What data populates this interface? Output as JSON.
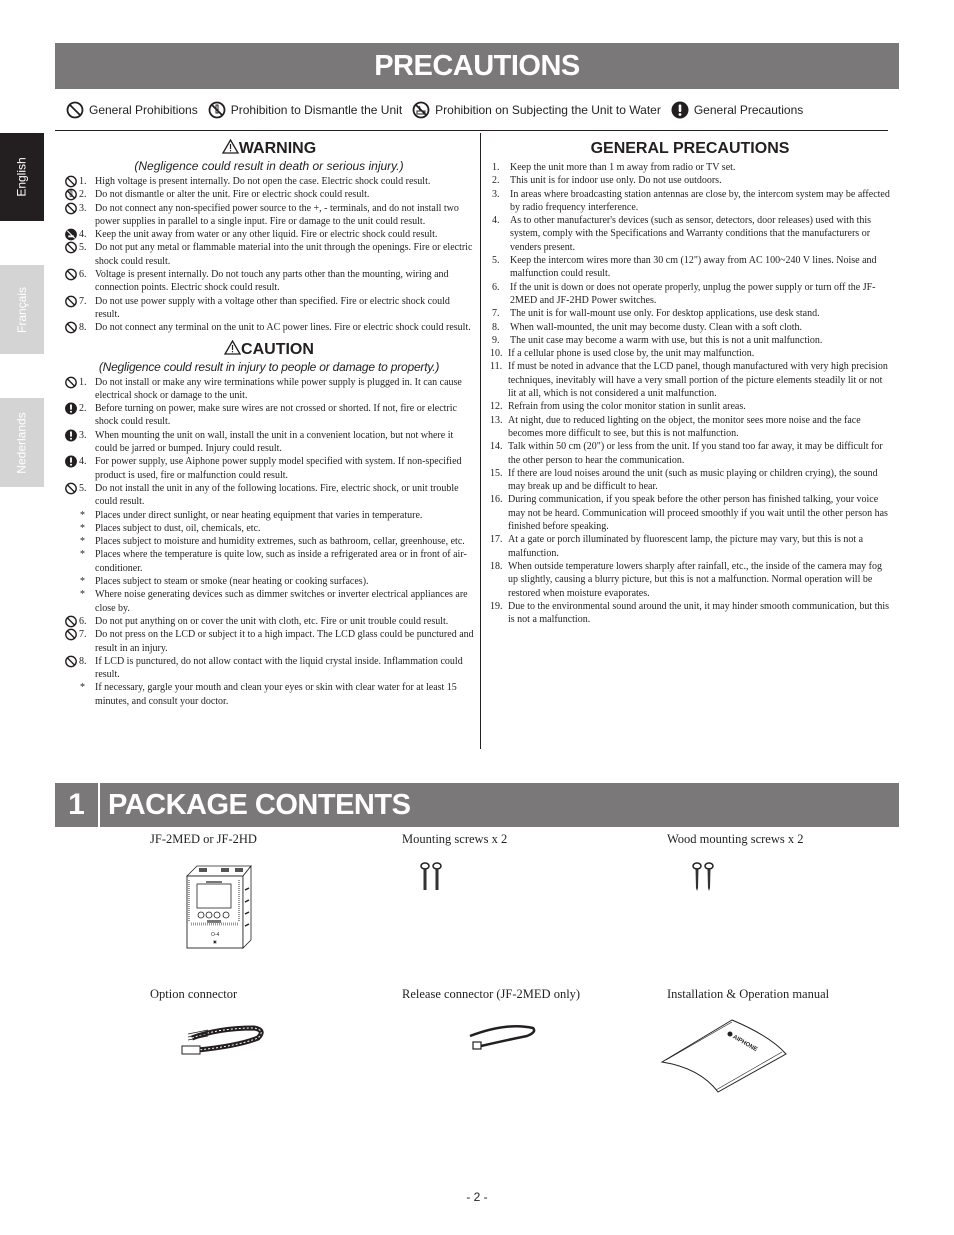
{
  "header": {
    "title": "PRECAUTIONS"
  },
  "legend": [
    {
      "icon": "general-prohibition-icon",
      "label": "General Prohibitions"
    },
    {
      "icon": "no-dismantle-icon",
      "label": "Prohibition to Dismantle the Unit"
    },
    {
      "icon": "no-water-icon",
      "label": "Prohibition on Subjecting the Unit to Water"
    },
    {
      "icon": "general-precaution-icon",
      "label": "General Precautions"
    }
  ],
  "language_tabs": [
    {
      "label": "English",
      "active": true
    },
    {
      "label": "Français",
      "active": false
    },
    {
      "label": "Nederlands",
      "active": false
    }
  ],
  "warning": {
    "title": "WARNING",
    "subtitle": "(Negligence could result in death or serious injury.)",
    "items": [
      {
        "icon": "prohibition",
        "num": "1.",
        "text": "High voltage is present internally. Do not open the case. Electric shock could result."
      },
      {
        "icon": "dismantle",
        "num": "2.",
        "text": "Do not dismantle or alter the unit. Fire or electric shock could result."
      },
      {
        "icon": "prohibition",
        "num": "3.",
        "text": "Do not connect any non-specified power source to the +, - terminals, and do not install two power supplies in parallel to a single input. Fire or damage to the unit could result."
      },
      {
        "icon": "water",
        "num": "4.",
        "text": "Keep the unit away from water or any other liquid. Fire or electric shock could result."
      },
      {
        "icon": "prohibition",
        "num": "5.",
        "text": "Do not put any metal or flammable material into the unit through the openings. Fire or electric shock could result."
      },
      {
        "icon": "prohibition",
        "num": "6.",
        "text": "Voltage is present internally. Do not touch any parts other than the mounting, wiring and connection points. Electric shock could result."
      },
      {
        "icon": "prohibition",
        "num": "7.",
        "text": "Do not use power supply with a voltage other than specified. Fire or electric shock could result."
      },
      {
        "icon": "prohibition",
        "num": "8.",
        "text": "Do not connect any terminal on the unit to AC power lines. Fire or electric shock could result."
      }
    ]
  },
  "caution": {
    "title": "CAUTION",
    "subtitle": "(Negligence could result in injury to people or damage to property.)",
    "items": [
      {
        "icon": "prohibition",
        "num": "1.",
        "text": "Do not install or make any wire terminations while power supply is plugged in. It can cause electrical shock or damage to the unit."
      },
      {
        "icon": "precaution",
        "num": "2.",
        "text": "Before turning on power, make sure wires are not crossed or shorted. If not, fire or electric shock could result."
      },
      {
        "icon": "precaution",
        "num": "3.",
        "text": "When mounting the unit on wall, install the unit in a convenient location, but not where it could be jarred or bumped. Injury could result."
      },
      {
        "icon": "precaution",
        "num": "4.",
        "text": "For power supply, use Aiphone power supply model specified with system. If non-specified product is used, fire or malfunction could result."
      },
      {
        "icon": "prohibition",
        "num": "5.",
        "text": "Do not install the unit in any of the following locations. Fire, electric shock, or unit trouble could result.",
        "subitems": [
          "Places under direct sunlight, or near heating equipment that varies in temperature.",
          "Places subject to dust, oil, chemicals, etc.",
          "Places subject to moisture and humidity extremes, such as bathroom, cellar, greenhouse, etc.",
          "Places where the temperature is quite low, such as inside a refrigerated area or in front of air-conditioner.",
          "Places subject to steam or smoke (near heating or cooking surfaces).",
          "Where noise generating devices such as dimmer switches or inverter electrical appliances are close by."
        ]
      },
      {
        "icon": "prohibition",
        "num": "6.",
        "text": "Do not put anything on or cover the unit with cloth, etc. Fire or unit trouble could result."
      },
      {
        "icon": "prohibition",
        "num": "7.",
        "text": "Do not press on the LCD or subject it to a high impact. The LCD glass could be punctured and result in an injury."
      },
      {
        "icon": "prohibition",
        "num": "8.",
        "text": "If LCD is punctured, do not allow contact with the liquid crystal inside. Inflammation could result.",
        "subitems": [
          "If necessary, gargle your mouth and clean your eyes or skin with clear water for at least 15 minutes, and consult your doctor."
        ]
      }
    ]
  },
  "general": {
    "title": "GENERAL PRECAUTIONS",
    "items": [
      {
        "num": "1.",
        "text": "Keep the unit more than 1 m away from radio or TV set."
      },
      {
        "num": "2.",
        "text": "This unit is for indoor use only. Do not use outdoors."
      },
      {
        "num": "3.",
        "text": "In areas where broadcasting station antennas are close by, the intercom system may be affected by radio frequency interference."
      },
      {
        "num": "4.",
        "text": "As to other manufacturer's devices (such as sensor, detectors, door releases) used with this system, comply with the Specifications and Warranty conditions that the manufacturers or venders present."
      },
      {
        "num": "5.",
        "text": "Keep the intercom wires more than 30 cm (12\") away from AC 100~240 V lines. Noise and malfunction could result."
      },
      {
        "num": "6.",
        "text": "If the unit is down or does not operate properly, unplug the power supply or turn off the JF-2MED and JF-2HD Power switches."
      },
      {
        "num": "7.",
        "text": "The unit is for wall-mount use only. For desktop applications, use desk stand."
      },
      {
        "num": "8.",
        "text": "When wall-mounted, the unit may become dusty. Clean with a soft cloth."
      },
      {
        "num": "9.",
        "text": "The unit case may become a warm with use, but this is not a unit malfunction."
      },
      {
        "num": "10.",
        "text": "If a cellular phone is used close by, the unit may malfunction."
      },
      {
        "num": "11.",
        "text": "If must be noted in advance that the LCD panel, though manufactured with very high precision techniques, inevitably will have a very small portion of the picture elements steadily lit or not lit at all, which is not considered a unit malfunction."
      },
      {
        "num": "12.",
        "text": "Refrain from using the color monitor station in sunlit areas."
      },
      {
        "num": "13.",
        "text": "At night, due to reduced lighting on the object, the monitor sees more noise and the face becomes more difficult to see, but this is not malfunction."
      },
      {
        "num": "14.",
        "text": "Talk within 50 cm (20\") or less from the unit. If you stand too far away, it may be difficult for the other person to hear the communication."
      },
      {
        "num": "15.",
        "text": "If there are loud noises around the unit (such as music playing or children crying), the sound may break up and be difficult to hear."
      },
      {
        "num": "16.",
        "text": "During communication, if you speak before the other person has finished talking, your voice may not be heard. Communication will proceed smoothly if you wait until the other person has finished before speaking."
      },
      {
        "num": "17.",
        "text": "At a gate or porch illuminated by fluorescent lamp, the picture may vary, but this is not a malfunction."
      },
      {
        "num": "18.",
        "text": "When outside temperature lowers sharply after rainfall, etc., the inside of the camera may fog up slightly, causing a blurry picture, but this is not a malfunction. Normal operation will be restored when moisture evaporates."
      },
      {
        "num": "19.",
        "text": "Due to the environmental sound around the unit, it may hinder smooth communication, but this is not a malfunction."
      }
    ]
  },
  "package": {
    "number": "1",
    "title": "PACKAGE CONTENTS",
    "items": [
      {
        "label": "JF-2MED or JF-2HD",
        "image": "monitor-unit"
      },
      {
        "label": "Mounting screws x 2",
        "image": "mounting-screws"
      },
      {
        "label": "Wood mounting screws x 2",
        "image": "wood-screws"
      },
      {
        "label": "Option connector",
        "image": "option-connector"
      },
      {
        "label": "Release connector (JF-2MED only)",
        "image": "release-connector"
      },
      {
        "label": "Installation & Operation manual",
        "image": "manual",
        "brand": "AIPHONE"
      }
    ]
  },
  "footer": {
    "page": "- 2 -"
  }
}
